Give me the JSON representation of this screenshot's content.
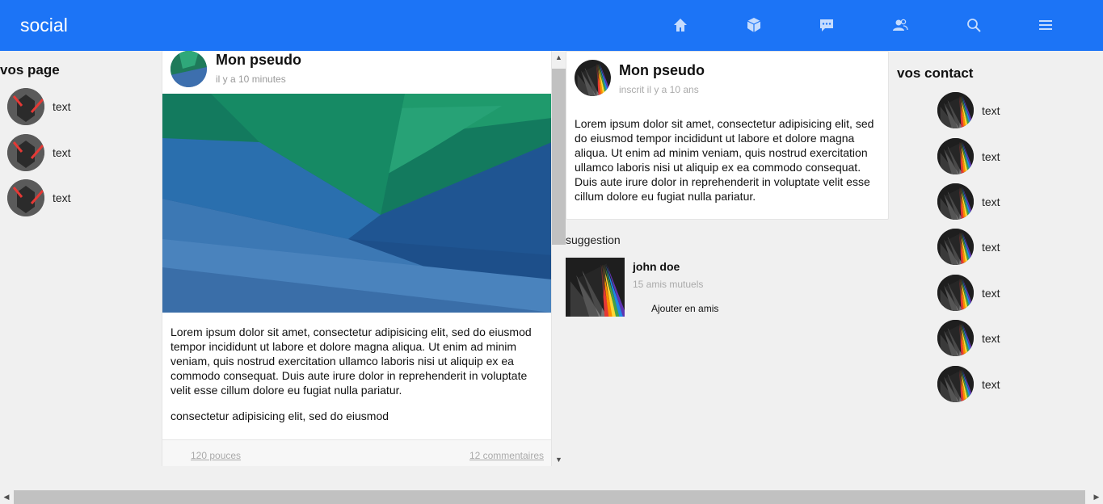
{
  "header": {
    "brand": "social",
    "nav_icons": [
      "home-icon",
      "cube-icon",
      "chat-icon",
      "friends-icon",
      "search-icon",
      "menu-icon"
    ],
    "color": "#1c74f6"
  },
  "left_sidebar": {
    "title": "vos page",
    "items": [
      {
        "label": "text"
      },
      {
        "label": "text"
      },
      {
        "label": "text"
      }
    ]
  },
  "post": {
    "author": "Mon pseudo",
    "time": "il y a 10 minutes",
    "text": "Lorem ipsum dolor sit amet, consectetur adipisicing elit, sed do eiusmod tempor incididunt ut labore et dolore magna aliqua. Ut enim ad minim veniam, quis nostrud exercitation ullamco laboris nisi ut aliquip ex ea commodo consequat. Duis aute irure dolor in reprehenderit in voluptate velit esse cillum dolore eu fugiat nulla pariatur.",
    "text2": "consectetur adipisicing elit, sed do eiusmod",
    "likes": "120 pouces",
    "comments": "12 commentaires"
  },
  "profile": {
    "name": "Mon pseudo",
    "subtitle": "inscrit il y a 10 ans",
    "bio": "Lorem ipsum dolor sit amet, consectetur adipisicing elit, sed do eiusmod tempor incididunt ut labore et dolore magna aliqua. Ut enim ad minim veniam, quis nostrud exercitation ullamco laboris nisi ut aliquip ex ea commodo consequat. Duis aute irure dolor in reprehenderit in voluptate velit esse cillum dolore eu fugiat nulla pariatur."
  },
  "suggestion": {
    "title": "suggestion",
    "name": "john doe",
    "mutual": "15 amis mutuels",
    "add_label": "Ajouter en amis"
  },
  "right_sidebar": {
    "title": "vos contact",
    "items": [
      {
        "label": "text"
      },
      {
        "label": "text"
      },
      {
        "label": "text"
      },
      {
        "label": "text"
      },
      {
        "label": "text"
      },
      {
        "label": "text"
      },
      {
        "label": "text"
      }
    ]
  }
}
